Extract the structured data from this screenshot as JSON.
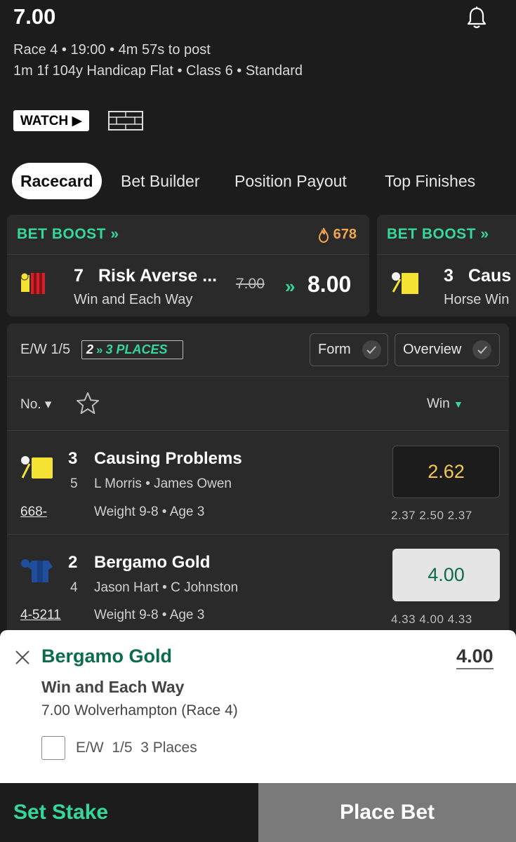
{
  "header": {
    "race_odds_title": "7.00",
    "meta_line1": "Race 4 • 19:00 • 4m 57s to post",
    "meta_line2": "1m 1f 104y Handicap Flat  • Class 6  • Standard",
    "watch_label": "WATCH ▶"
  },
  "tabs": [
    {
      "label": "Racecard",
      "active": true
    },
    {
      "label": "Bet Builder",
      "active": false
    },
    {
      "label": "Position Payout",
      "active": false
    },
    {
      "label": "Top Finishes",
      "active": false
    }
  ],
  "boosts": [
    {
      "title": "BET BOOST »",
      "count": "678",
      "runner_number": "7",
      "runner_name": "Risk Averse ...",
      "market": "Win and Each Way",
      "old_odds": "7.00",
      "arrows": "»",
      "new_odds": "8.00"
    },
    {
      "title": "BET BOOST »",
      "runner_number": "3",
      "runner_name": "Caus",
      "market": "Horse Win"
    }
  ],
  "racecard": {
    "ew_terms": "E/W 1/5",
    "places_badge": {
      "num": "2",
      "arrows": "»",
      "text": "3 PLACES"
    },
    "form_label": "Form",
    "overview_label": "Overview",
    "col_no": "No. ▾",
    "col_win": "Win",
    "col_win_arrow": "▼"
  },
  "runners": [
    {
      "number": "3",
      "draw": "5",
      "name": "Causing Problems",
      "people": "L Morris • James Owen",
      "form": "668-",
      "weight_age": "Weight 9-8 • Age 3",
      "odds": "2.62",
      "history": "2.37  2.50  2.37",
      "silk_color": "#f5e334"
    },
    {
      "number": "2",
      "draw": "4",
      "name": "Bergamo Gold",
      "people": "Jason Hart • C Johnston",
      "form": "4-5211",
      "weight_age": "Weight 9-8 • Age 3",
      "odds": "4.00",
      "history": "4.33  4.00  4.33",
      "silk_color": "#1f4f9c"
    }
  ],
  "betslip": {
    "selection": "Bergamo Gold",
    "odds": "4.00",
    "market": "Win and Each Way",
    "event": "7.00 Wolverhampton (Race 4)",
    "ew_label": "E/W  1/5  3 Places",
    "set_stake_label": "Set Stake",
    "place_bet_label": "Place Bet"
  },
  "colors": {
    "accent_green": "#35d79a",
    "odds_yellow": "#f5c94c",
    "slip_green": "#0b6b4a",
    "flame_orange": "#f0a64c"
  }
}
